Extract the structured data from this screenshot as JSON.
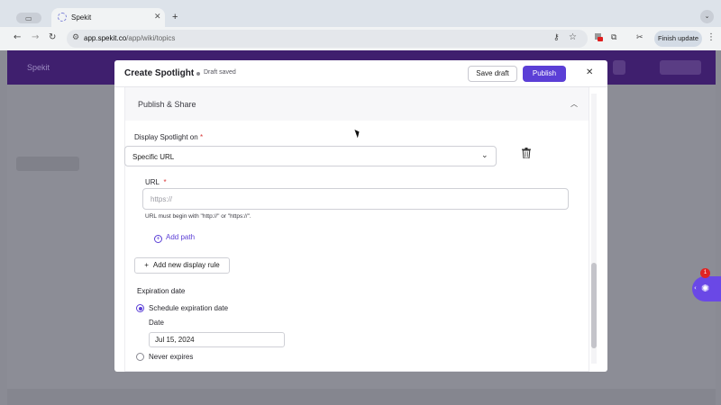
{
  "browser": {
    "tab_title": "Spekit",
    "tab_close": "✕",
    "new_tab": "+",
    "tab_menu": "⌄",
    "url_host": "app.spekit.co",
    "url_path": "/app/wiki/topics",
    "finish_update": "Finish update",
    "icons": [
      "back-icon",
      "forward-icon",
      "reload-icon",
      "tune-icon",
      "key-icon",
      "star-icon",
      "extension-icon",
      "puzzle-icon",
      "profile-icon",
      "menu-dots-icon"
    ]
  },
  "app": {
    "logo": "Spekit"
  },
  "modal": {
    "title": "Create Spotlight",
    "draft_status": "Draft saved",
    "save_draft": "Save draft",
    "publish": "Publish",
    "close": "✕",
    "section": {
      "title": "Publish & Share",
      "display_label": "Display Spotlight on",
      "required_mark": "*",
      "display_value": "Specific URL",
      "url_label": "URL",
      "url_placeholder": "https://",
      "url_value": "",
      "url_hint": "URL must begin with \"http://\" or \"https://\".",
      "add_path": "Add path",
      "add_rule": "Add new display rule",
      "expiration_title": "Expiration date",
      "schedule_option": "Schedule expiration date",
      "date_label": "Date",
      "date_value": "Jul 15, 2024",
      "never_option": "Never expires",
      "selected_expiration": "Schedule expiration date"
    }
  },
  "widget": {
    "badge_count": "1",
    "collapse": "‹"
  },
  "colors": {
    "accent": "#5b3fd6",
    "required": "#d93636",
    "app_header": "#3f1f6e",
    "badge": "#e02424"
  }
}
